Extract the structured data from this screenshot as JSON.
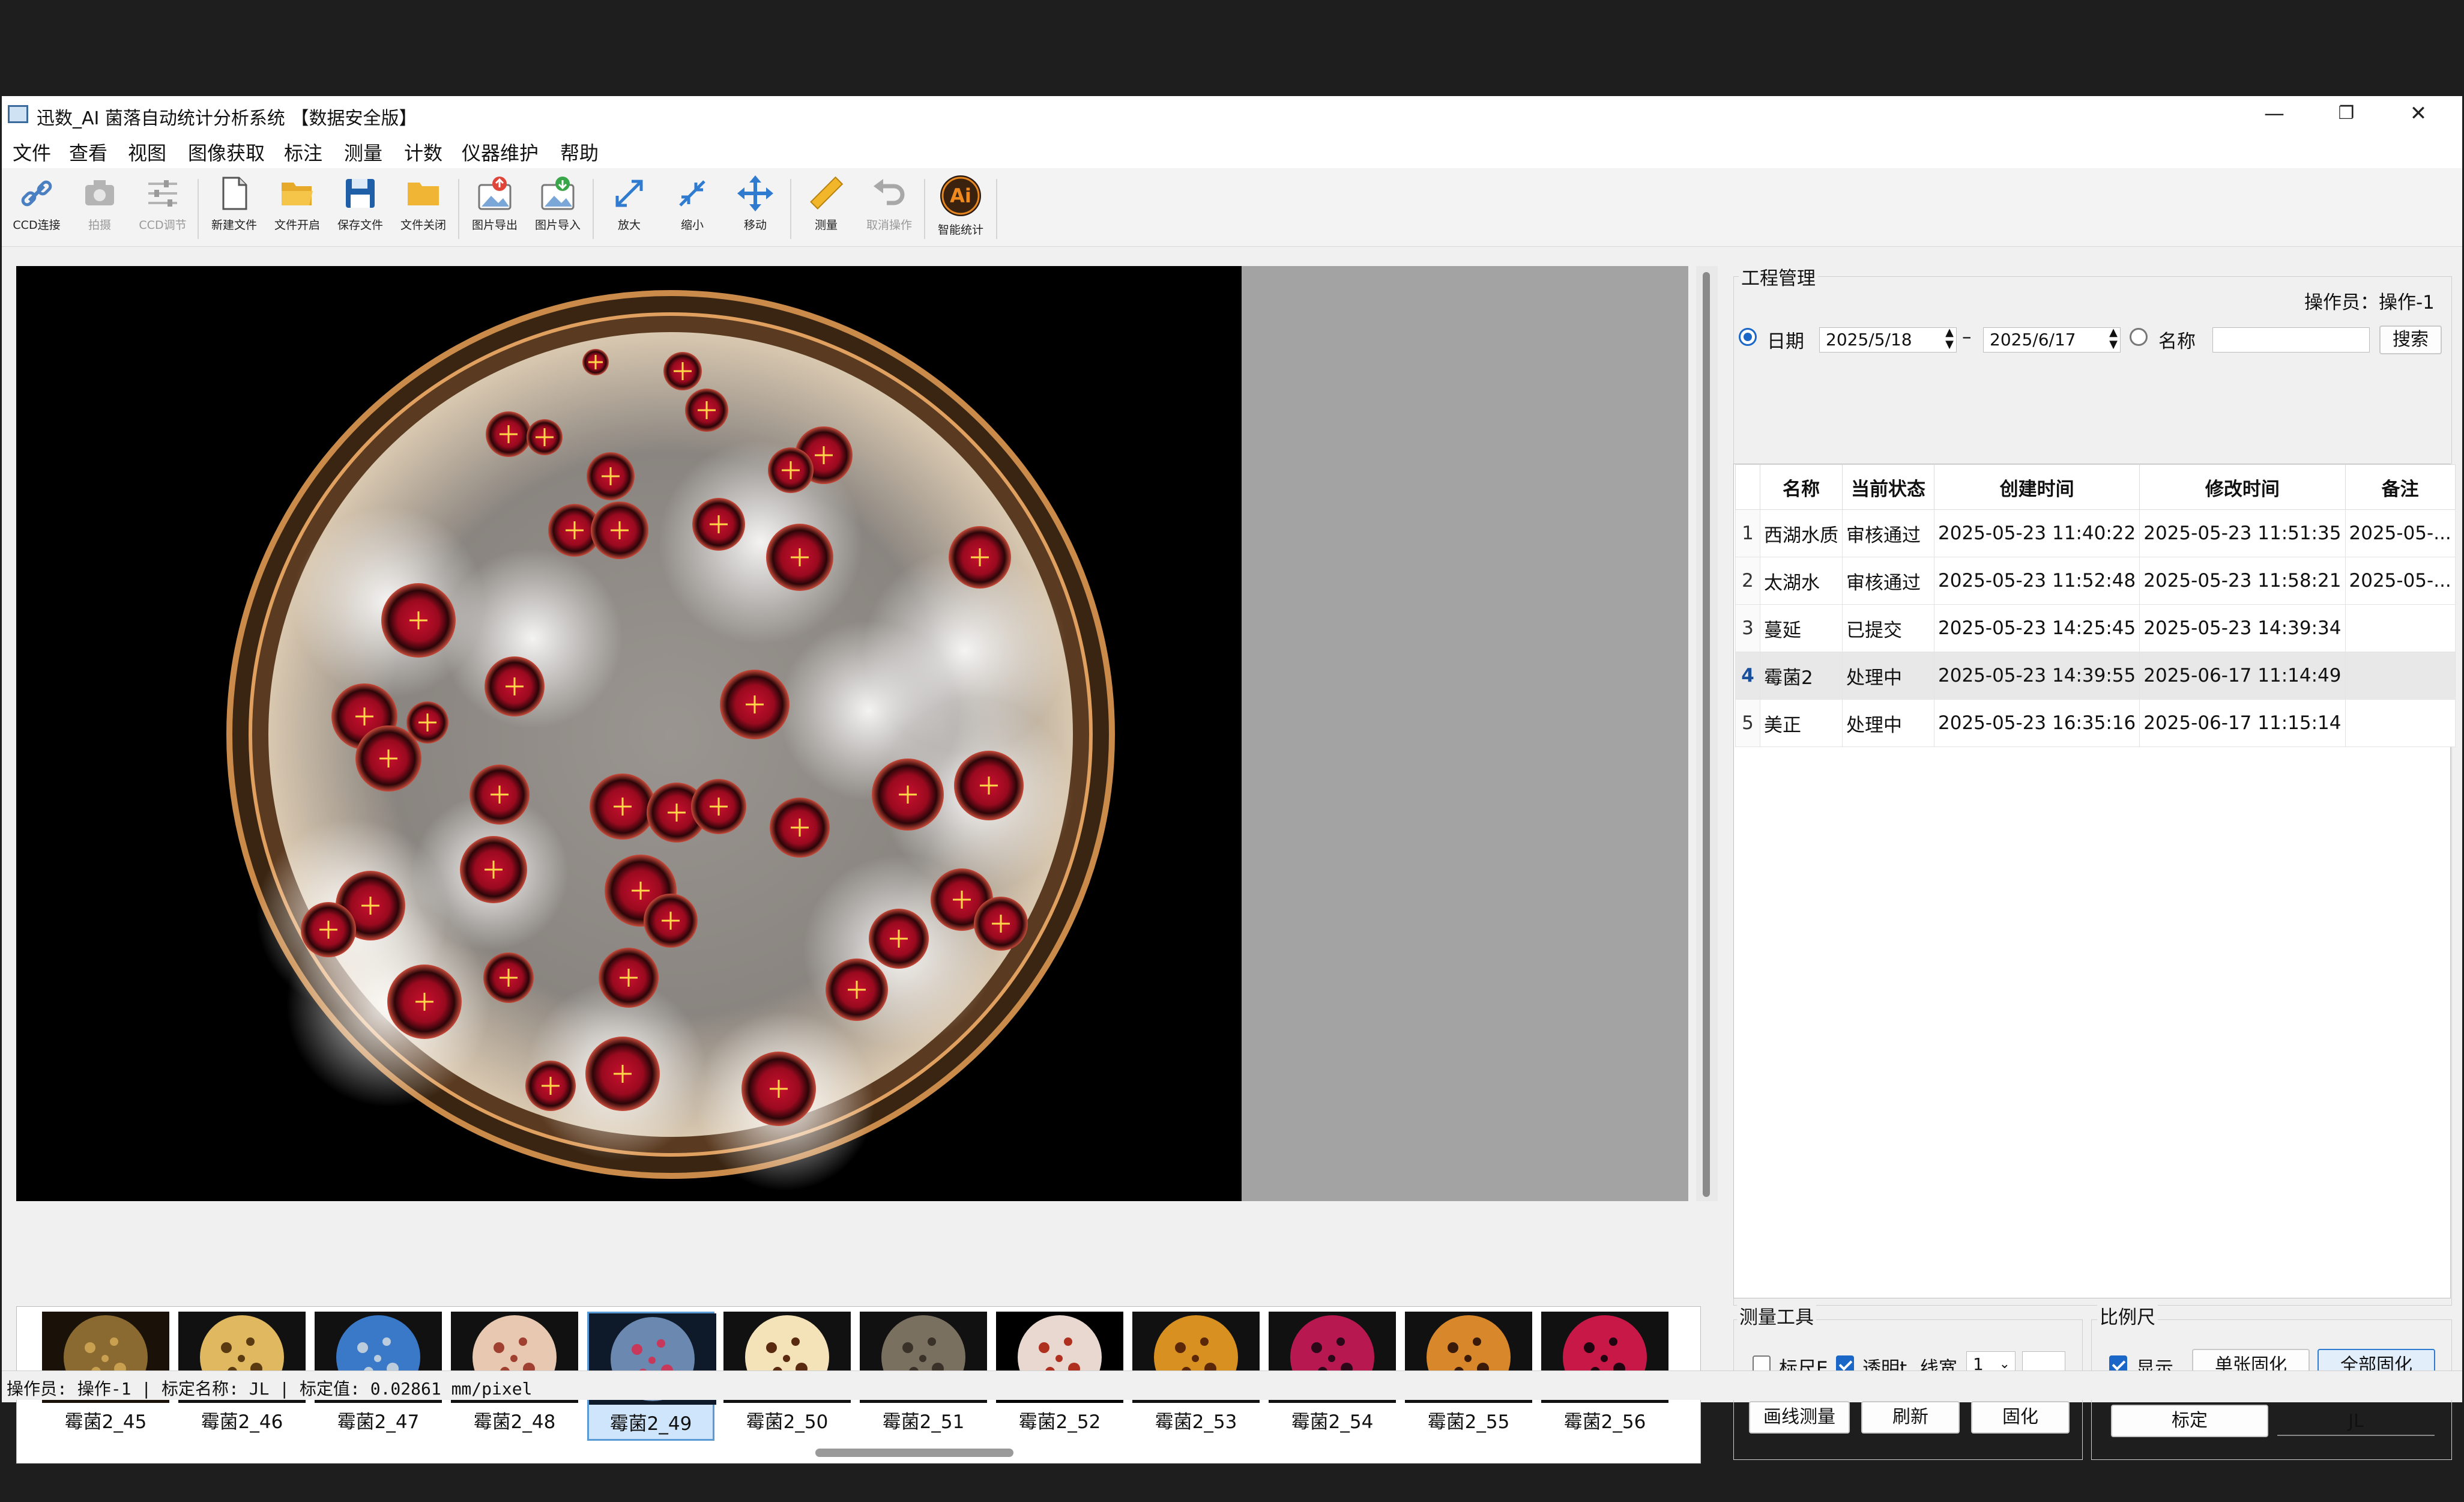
{
  "window": {
    "title": "迅数_AI 菌落自动统计分析系统 【数据安全版】"
  },
  "menu": [
    "文件",
    "查看",
    "视图",
    "图像获取",
    "标注",
    "测量",
    "计数",
    "仪器维护",
    "帮助"
  ],
  "toolbar": [
    {
      "label": "CCD连接",
      "icon": "link-icon",
      "enabled": true
    },
    {
      "label": "拍摄",
      "icon": "camera-icon",
      "enabled": false
    },
    {
      "label": "CCD调节",
      "icon": "sliders-icon",
      "enabled": false
    },
    {
      "label": "新建文件",
      "icon": "new-file-icon",
      "enabled": true
    },
    {
      "label": "文件开启",
      "icon": "folder-open-icon",
      "enabled": true
    },
    {
      "label": "保存文件",
      "icon": "save-icon",
      "enabled": true
    },
    {
      "label": "文件关闭",
      "icon": "folder-icon",
      "enabled": true
    },
    {
      "label": "图片导出",
      "icon": "image-export-icon",
      "enabled": true
    },
    {
      "label": "图片导入",
      "icon": "image-import-icon",
      "enabled": true
    },
    {
      "label": "放大",
      "icon": "zoom-in-icon",
      "enabled": true
    },
    {
      "label": "缩小",
      "icon": "zoom-out-icon",
      "enabled": true
    },
    {
      "label": "移动",
      "icon": "move-icon",
      "enabled": true
    },
    {
      "label": "测量",
      "icon": "ruler-icon",
      "enabled": true
    },
    {
      "label": "取消操作",
      "icon": "undo-icon",
      "enabled": false
    },
    {
      "label": "智能统计",
      "icon": "ai-icon",
      "enabled": true
    }
  ],
  "thumbnails": [
    {
      "label": "霉菌2_45",
      "selected": false
    },
    {
      "label": "霉菌2_46",
      "selected": false
    },
    {
      "label": "霉菌2_47",
      "selected": false
    },
    {
      "label": "霉菌2_48",
      "selected": false
    },
    {
      "label": "霉菌2_49",
      "selected": true
    },
    {
      "label": "霉菌2_50",
      "selected": false
    },
    {
      "label": "霉菌2_51",
      "selected": false
    },
    {
      "label": "霉菌2_52",
      "selected": false
    },
    {
      "label": "霉菌2_53",
      "selected": false
    },
    {
      "label": "霉菌2_54",
      "selected": false
    },
    {
      "label": "霉菌2_55",
      "selected": false
    },
    {
      "label": "霉菌2_56",
      "selected": false
    }
  ],
  "project": {
    "title": "工程管理",
    "operator_label": "操作员：操作-1",
    "date_radio_label": "日期",
    "date_from": "2025/5/18",
    "date_sep": "–",
    "date_to": "2025/6/17",
    "name_radio_label": "名称",
    "name_value": "",
    "search_label": "搜索",
    "columns": [
      "名称",
      "当前状态",
      "创建时间",
      "修改时间",
      "备注"
    ],
    "rows": [
      {
        "idx": "1",
        "name": "西湖水质",
        "status": "审核通过",
        "created": "2025-05-23 11:40:22",
        "modified": "2025-05-23 11:51:35",
        "note": "2025-05-..."
      },
      {
        "idx": "2",
        "name": "太湖水",
        "status": "审核通过",
        "created": "2025-05-23 11:52:48",
        "modified": "2025-05-23 11:58:21",
        "note": "2025-05-..."
      },
      {
        "idx": "3",
        "name": "蔓延",
        "status": "已提交",
        "created": "2025-05-23 14:25:45",
        "modified": "2025-05-23 14:39:34",
        "note": ""
      },
      {
        "idx": "4",
        "name": "霉菌2",
        "status": "处理中",
        "created": "2025-05-23 14:39:55",
        "modified": "2025-06-17 11:14:49",
        "note": ""
      },
      {
        "idx": "5",
        "name": "美正",
        "status": "处理中",
        "created": "2025-05-23 16:35:16",
        "modified": "2025-06-17 11:15:14",
        "note": ""
      }
    ],
    "selected_row": "4"
  },
  "measure": {
    "title": "测量工具",
    "scale_bar_label": "标尺E",
    "transparent_label": "透明t",
    "line_width_label": "线宽",
    "line_width_value": "1",
    "draw_label": "画线测量",
    "refresh_label": "刷新",
    "fix_label": "固化"
  },
  "scale": {
    "title": "比例尺",
    "show_label": "显示",
    "single_fix_label": "单张固化",
    "all_fix_label": "全部固化",
    "calibrate_label": "标定",
    "calib_name": "JL"
  },
  "status": {
    "text": "操作员: 操作-1 | 标定名称: JL | 标定值: 0.02861 mm/pixel"
  },
  "colors": {
    "accent": "#1a67c7",
    "window_bg": "#f0f0f0",
    "viewer_bg": "#000000",
    "viewer_gray": "#a3a3a3"
  }
}
